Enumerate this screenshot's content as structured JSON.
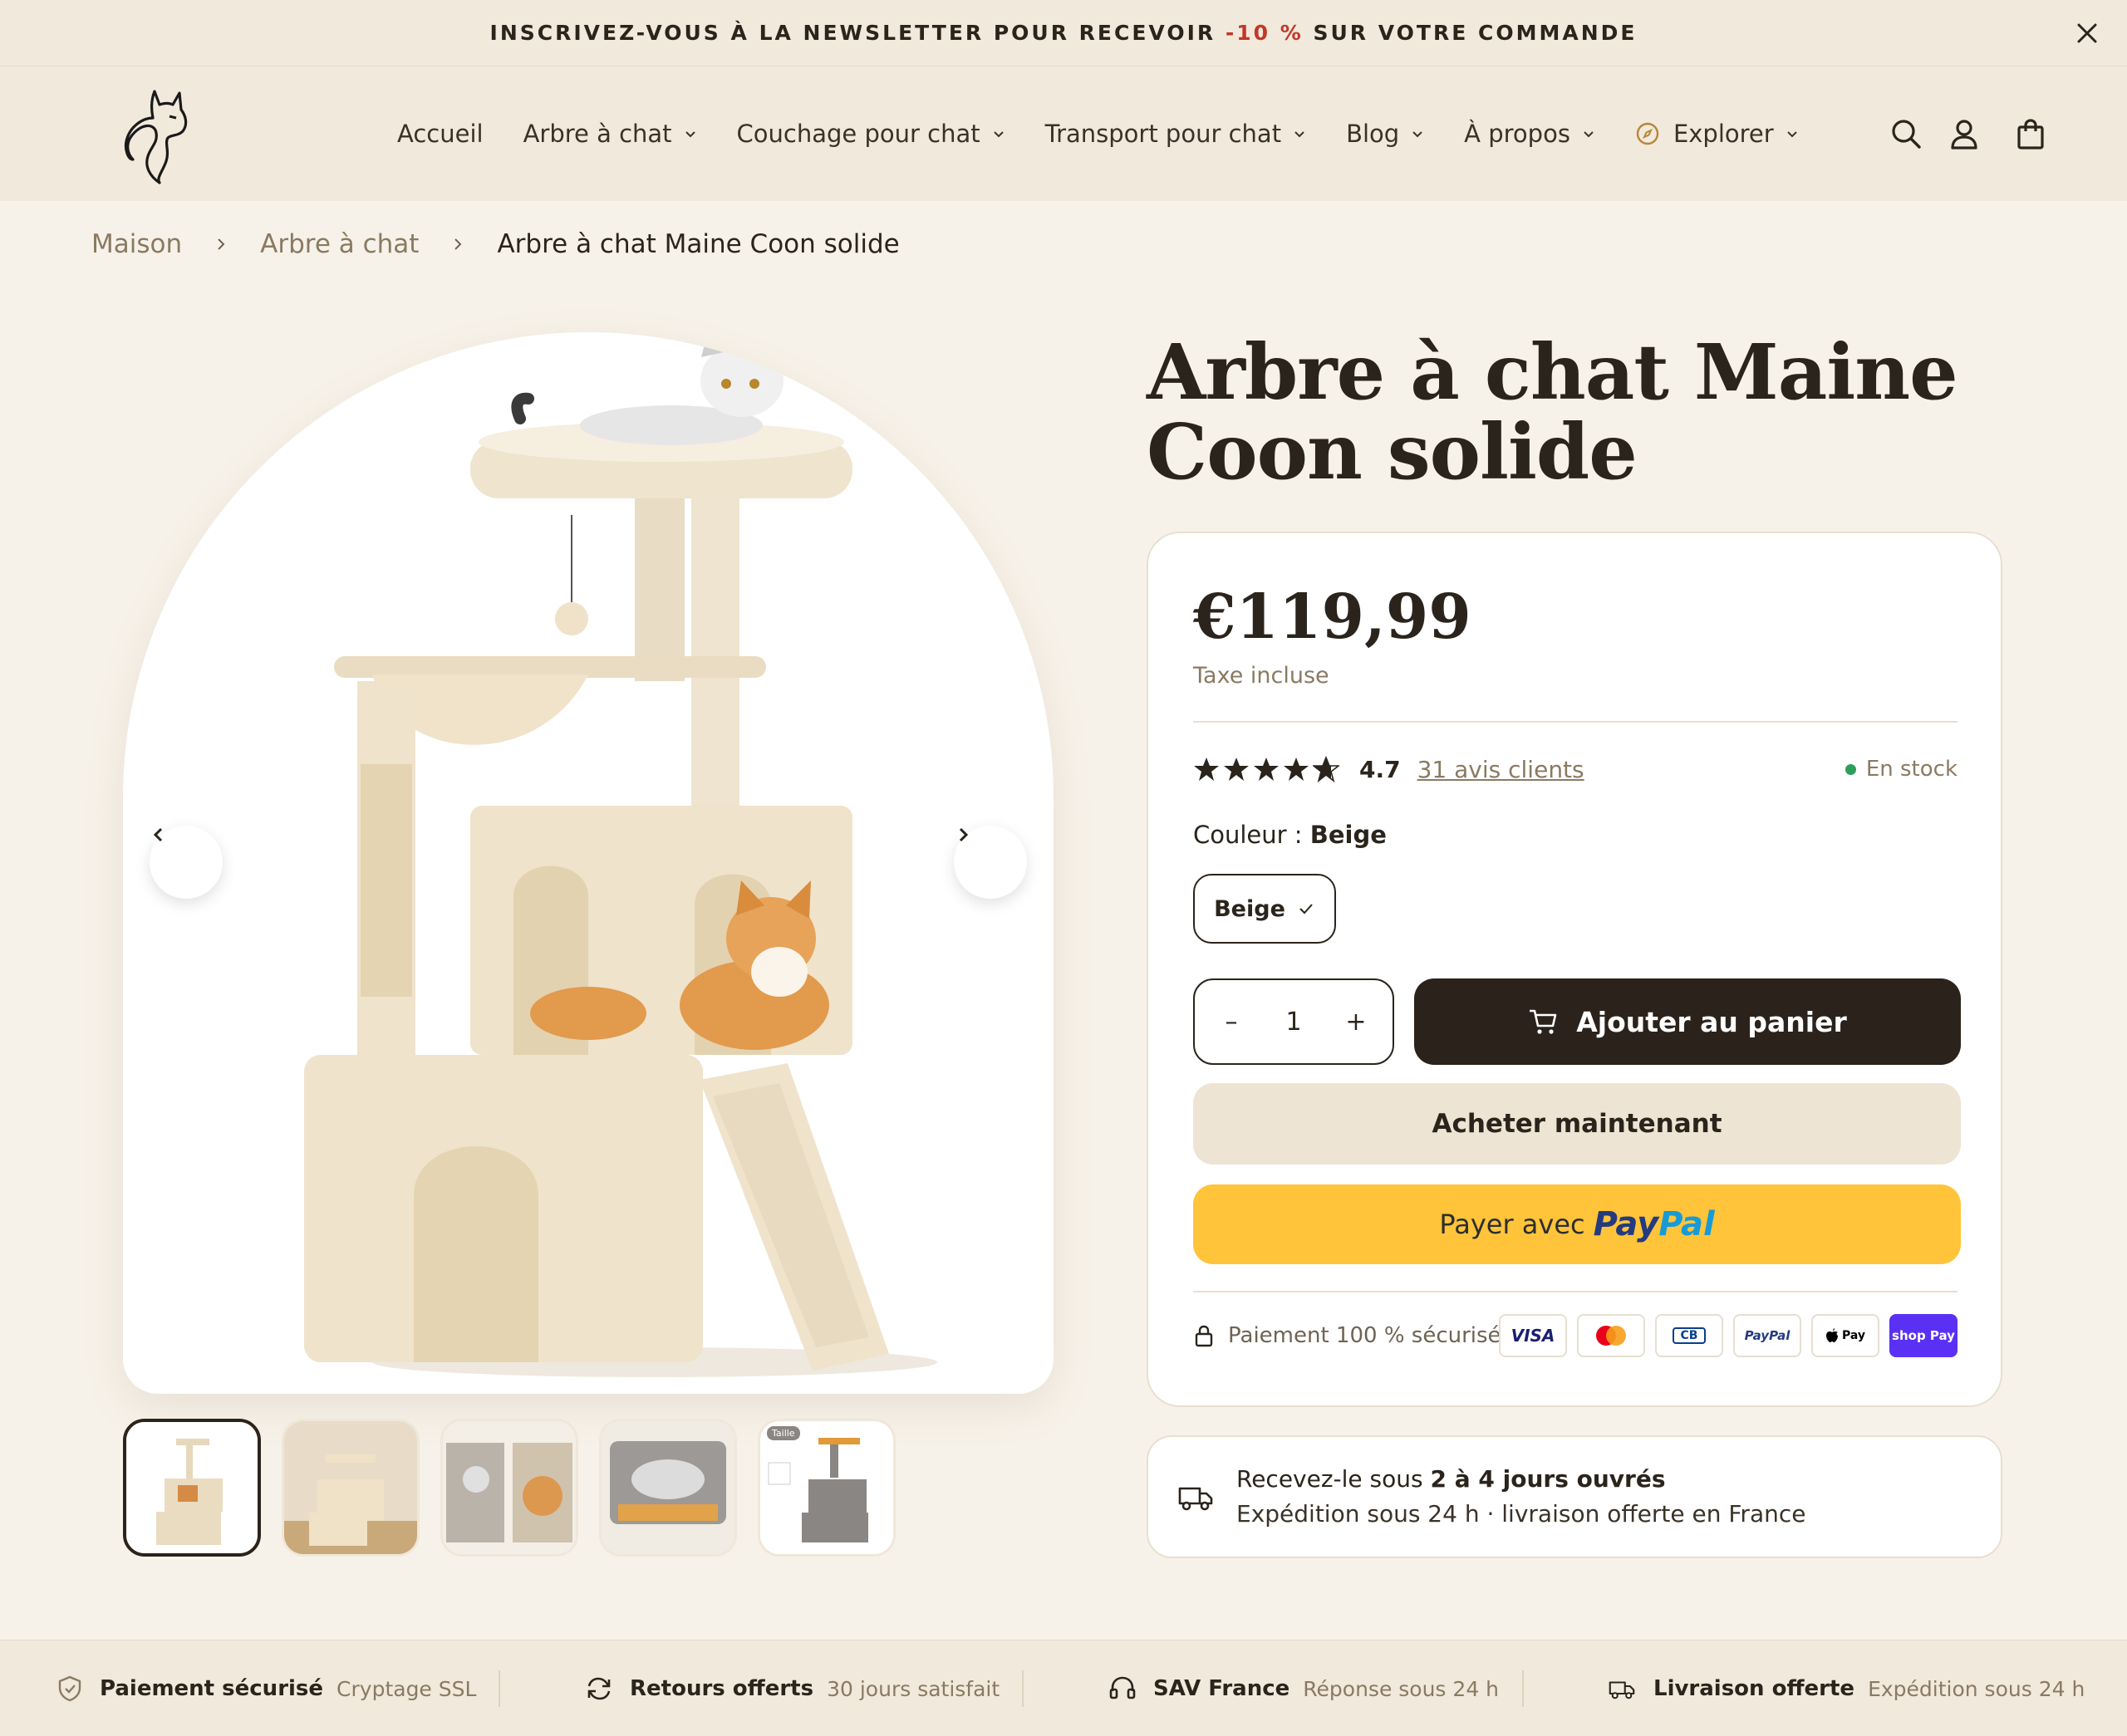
{
  "announcement": {
    "text_before": "INSCRIVEZ-VOUS À LA NEWSLETTER POUR RECEVOIR ",
    "highlight": "-10 %",
    "text_after": " SUR VOTRE COMMANDE"
  },
  "nav": {
    "items": [
      {
        "label": "Accueil"
      },
      {
        "label": "Arbre à chat"
      },
      {
        "label": "Couchage pour chat"
      },
      {
        "label": "Transport pour chat"
      },
      {
        "label": "Blog"
      },
      {
        "label": "À propos"
      },
      {
        "label": "Explorer"
      }
    ]
  },
  "breadcrumb": {
    "items": [
      "Maison",
      "Arbre à chat"
    ],
    "current": "Arbre à chat Maine Coon solide"
  },
  "gallery": {
    "thumbnail_count": 5,
    "active_index": 0,
    "thumb_badge": "Taille"
  },
  "product": {
    "title": "Arbre à chat Maine Coon solide",
    "price": "€119,99",
    "tax_note": "Taxe incluse",
    "rating": "4.7",
    "rating_value": 4.7,
    "reviews_link": "31 avis clients",
    "stock": "En stock",
    "color_label": "Couleur : ",
    "color_value": "Beige",
    "swatch": "Beige",
    "quantity": "1",
    "add_to_cart": "Ajouter au panier",
    "buy_now": "Acheter maintenant",
    "paypal_prefix": "Payer avec",
    "paypal_pay": "Pay",
    "paypal_pal": "Pal",
    "secure_text": "Paiement 100 % sécurisé",
    "payment_methods": [
      "VISA",
      "Mastercard",
      "CB",
      "PayPal",
      "Apple Pay",
      "shop Pay"
    ]
  },
  "delivery": {
    "line1_before": "Recevez-le sous ",
    "line1_bold": "2 à 4 jours ouvrés",
    "line2": "Expédition sous 24 h · livraison offerte en France"
  },
  "trust": [
    {
      "title": "Paiement sécurisé",
      "subtitle": "Cryptage SSL"
    },
    {
      "title": "Retours offerts",
      "subtitle": "30 jours satisfait"
    },
    {
      "title": "SAV France",
      "subtitle": "Réponse sous 24 h"
    },
    {
      "title": "Livraison offerte",
      "subtitle": "Expédition sous 24 h"
    }
  ],
  "colors": {
    "background": "#f7f2e9",
    "header": "#f1e9db",
    "dark": "#2b231b",
    "accent_red": "#c0392b",
    "stock_green": "#2e9e5b",
    "paypal_yellow": "#ffc439"
  }
}
